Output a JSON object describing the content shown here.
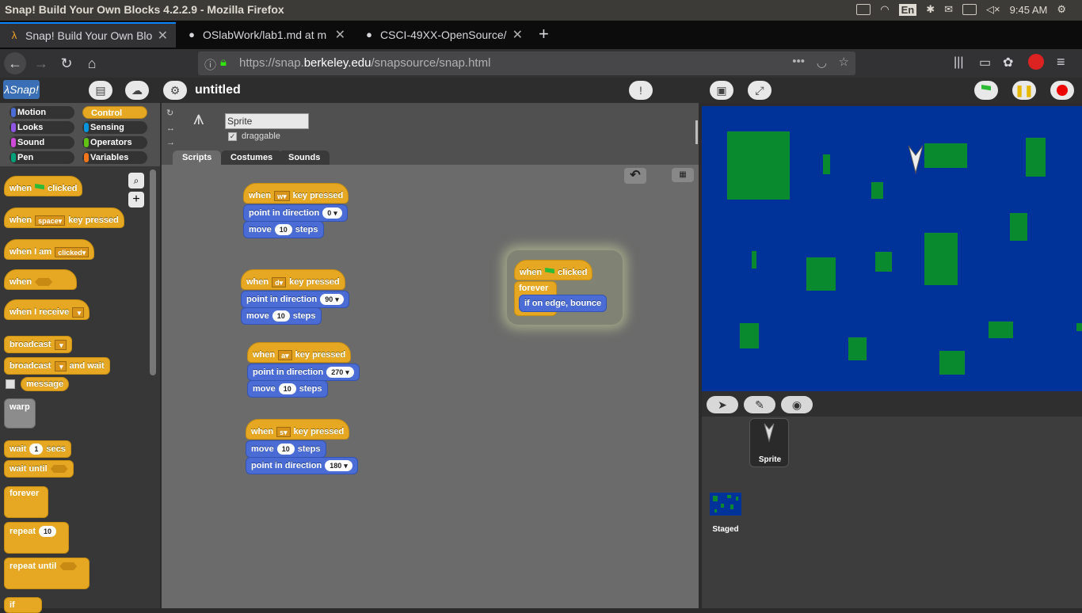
{
  "os": {
    "window_title": "Snap! Build Your Own Blocks 4.2.2.9 - Mozilla Firefox",
    "lang": "En",
    "time": "9:45 AM"
  },
  "tabs": [
    {
      "label": "Snap! Build Your Own Blo"
    },
    {
      "label": "OSlabWork/lab1.md at m"
    },
    {
      "label": "CSCI-49XX-OpenSource/"
    }
  ],
  "url": {
    "prefix": "https://snap.",
    "domain": "berkeley.edu",
    "path": "/snapsource/snap.html"
  },
  "snap": {
    "logo": "λSnap!",
    "project_name": "untitled",
    "categories": [
      {
        "label": "Motion",
        "color": "#4a6cd4"
      },
      {
        "label": "Control",
        "color": "#e6a822"
      },
      {
        "label": "Looks",
        "color": "#8f56e3"
      },
      {
        "label": "Sensing",
        "color": "#0494dc"
      },
      {
        "label": "Sound",
        "color": "#cf4ad9"
      },
      {
        "label": "Operators",
        "color": "#62c213"
      },
      {
        "label": "Pen",
        "color": "#00a178"
      },
      {
        "label": "Variables",
        "color": "#f3761d"
      }
    ],
    "palette": {
      "when": "when",
      "clicked": "clicked",
      "space": "space",
      "key_pressed": "key pressed",
      "when_i_am": "when I am",
      "clicked_opt": "clicked",
      "when_i_receive": "when I receive",
      "broadcast": "broadcast",
      "and_wait": "and wait",
      "message": "message",
      "warp": "warp",
      "wait": "wait",
      "wait_val": "1",
      "secs": "secs",
      "wait_until": "wait until",
      "forever": "forever",
      "repeat": "repeat",
      "repeat_val": "10",
      "repeat_until": "repeat until",
      "if": "if"
    },
    "sprite": {
      "name": "Sprite",
      "draggable": "draggable"
    },
    "sprite_tabs": [
      "Scripts",
      "Costumes",
      "Sounds"
    ],
    "scripts": {
      "w": "w",
      "d": "d",
      "a": "a",
      "s": "s",
      "key_pressed": "key pressed",
      "point_in_direction": "point in direction",
      "move": "move",
      "steps": "steps",
      "dir_w": "0",
      "dir_d": "90",
      "dir_a": "270",
      "dir_s": "180",
      "steps_val": "10",
      "forever": "forever",
      "bounce": "if on edge, bounce"
    },
    "corral": {
      "sprite_label": "Sprite",
      "stage_label": "Staged"
    }
  }
}
